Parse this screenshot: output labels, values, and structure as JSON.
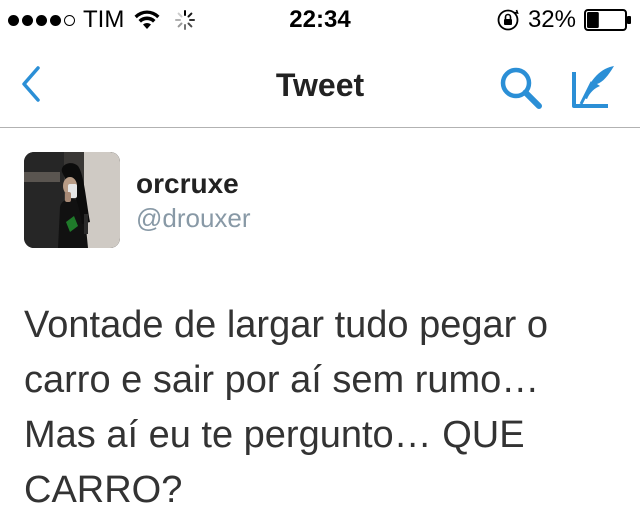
{
  "status_bar": {
    "signal_dots_filled": 4,
    "signal_dots_total": 5,
    "carrier": "TIM",
    "time": "22:34",
    "battery_percent": "32%",
    "battery_level": 0.32,
    "icons": [
      "wifi-icon",
      "activity-spinner-icon",
      "orientation-lock-icon",
      "battery-icon"
    ]
  },
  "navbar": {
    "title": "Tweet",
    "accent_color": "#2b8fd6",
    "icons": [
      "back-chevron-icon",
      "search-icon",
      "compose-icon"
    ]
  },
  "tweet": {
    "display_name": "orcruxe",
    "handle": "@drouxer",
    "text": "Vontade de largar tudo pegar o\ncarro e sair por aí sem rumo…\nMas aí eu te pergunto… QUE\nCARRO?"
  }
}
